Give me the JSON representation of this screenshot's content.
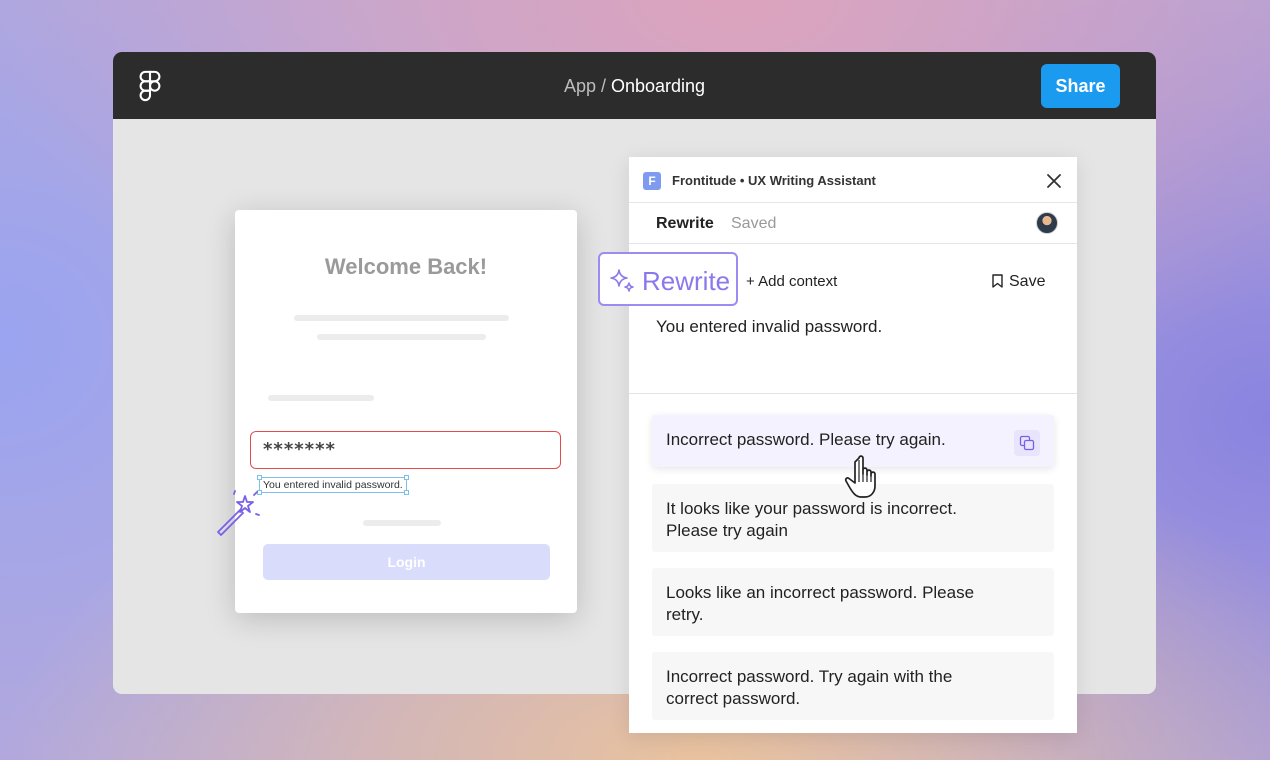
{
  "window": {
    "breadcrumb_parent": "App",
    "breadcrumb_sep": " / ",
    "breadcrumb_current": "Onboarding",
    "share_label": "Share"
  },
  "login_card": {
    "title": "Welcome Back!",
    "password_value": "*******",
    "error_message": "You entered invalid password.",
    "login_label": "Login"
  },
  "panel": {
    "logo_letter": "F",
    "title": "Frontitude • UX Writing Assistant",
    "tabs": [
      {
        "label": "Rewrite",
        "active": true
      },
      {
        "label": "Saved",
        "active": false
      }
    ],
    "rewrite_label": "Rewrite",
    "add_context_label": "+ Add context",
    "save_label": "Save",
    "original_text": "You entered invalid password.",
    "suggestions": [
      "Incorrect password. Please try again.",
      "It looks like your password is incorrect. Please try again",
      "Looks like an incorrect password. Please retry.",
      "Incorrect password. Try again with the correct password."
    ]
  },
  "icons": {
    "logo": "figma-logo-icon",
    "wand": "magic-wand-icon",
    "sparkle": "sparkle-icon",
    "close": "close-icon",
    "bookmark": "bookmark-icon",
    "copy": "copy-icon",
    "cursor": "hand-pointer-icon"
  },
  "colors": {
    "topbar": "#2c2c2c",
    "share": "#1b9bf0",
    "accent_purple": "#8a78ec",
    "error_red": "#e24c4c",
    "selection_blue": "#7dc1e6"
  }
}
